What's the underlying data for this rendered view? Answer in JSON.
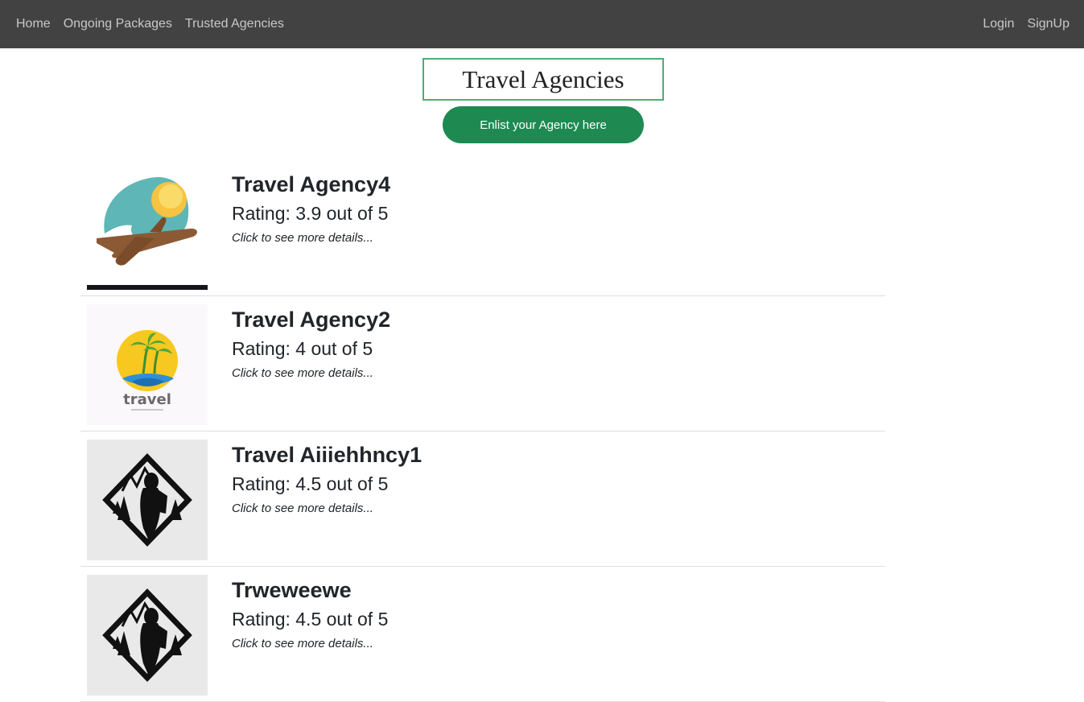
{
  "nav": {
    "left": [
      "Home",
      "Ongoing Packages",
      "Trusted Agencies"
    ],
    "right": [
      "Login",
      "SignUp"
    ]
  },
  "page": {
    "title": "Travel Agencies",
    "enlist_button": "Enlist your Agency here"
  },
  "agencies": [
    {
      "name": "Travel Agency4",
      "rating": "Rating: 3.9 out of 5",
      "details": "Click to see more details...",
      "logo": "airplane-sun-logo"
    },
    {
      "name": "Travel Agency2",
      "rating": "Rating: 4 out of 5",
      "details": "Click to see more details...",
      "logo": "palm-island-logo",
      "logo_text": "travel"
    },
    {
      "name": "Travel Aiiiehhncy1",
      "rating": "Rating: 4.5 out of 5",
      "details": "Click to see more details...",
      "logo": "hiker-mountain-logo"
    },
    {
      "name": "Trweweewe",
      "rating": "Rating: 4.5 out of 5",
      "details": "Click to see more details...",
      "logo": "hiker-mountain-logo"
    }
  ],
  "colors": {
    "navbar": "#424242",
    "nav_link": "#c8c8c8",
    "title_border": "#4cae72",
    "button": "#1e8a52"
  }
}
